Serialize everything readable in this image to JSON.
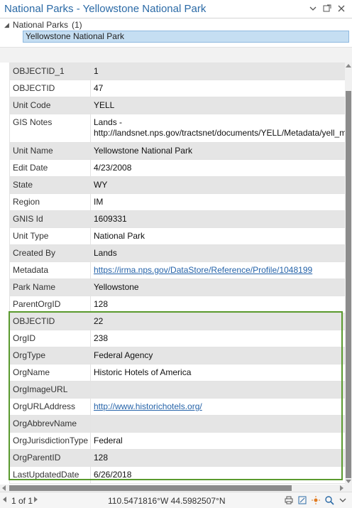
{
  "window": {
    "title": "National Parks - Yellowstone National Park"
  },
  "tree": {
    "layer_label": "National Parks",
    "layer_count": "(1)",
    "selected_feature": "Yellowstone National Park"
  },
  "attributes": [
    {
      "field": "OBJECTID_1",
      "value": "1"
    },
    {
      "field": "OBJECTID",
      "value": "47"
    },
    {
      "field": "Unit Code",
      "value": "YELL"
    },
    {
      "field": "GIS Notes",
      "value": "Lands - http://landsnet.nps.gov/tractsnet/documents/YELL/Metadata/yell_m"
    },
    {
      "field": "Unit Name",
      "value": "Yellowstone National Park"
    },
    {
      "field": "Edit Date",
      "value": "4/23/2008"
    },
    {
      "field": "State",
      "value": "WY"
    },
    {
      "field": "Region",
      "value": "IM"
    },
    {
      "field": "GNIS Id",
      "value": "1609331"
    },
    {
      "field": "Unit Type",
      "value": "National Park"
    },
    {
      "field": "Created By",
      "value": "Lands"
    },
    {
      "field": "Metadata",
      "value": "https://irma.nps.gov/DataStore/Reference/Profile/1048199"
    },
    {
      "field": "Park Name",
      "value": "Yellowstone"
    },
    {
      "field": "ParentOrgID",
      "value": "128"
    },
    {
      "field": "OBJECTID",
      "value": "22"
    },
    {
      "field": "OrgID",
      "value": "238"
    },
    {
      "field": "OrgType",
      "value": "Federal Agency"
    },
    {
      "field": "OrgName",
      "value": "Historic Hotels of America"
    },
    {
      "field": "OrgImageURL",
      "value": ""
    },
    {
      "field": "OrgURLAddress",
      "value": "http://www.historichotels.org/"
    },
    {
      "field": "OrgAbbrevName",
      "value": ""
    },
    {
      "field": "OrgJurisdictionType",
      "value": "Federal"
    },
    {
      "field": "OrgParentID",
      "value": "128"
    },
    {
      "field": "LastUpdatedDate",
      "value": "6/26/2018"
    }
  ],
  "status": {
    "page": "1 of 1",
    "coordinates": "110.5471816°W 44.5982507°N"
  },
  "colors": {
    "title": "#2b6aa6",
    "highlight": "#5a9a2e",
    "link": "#2563a9",
    "selected_row": "#c5def2"
  },
  "icons": [
    "options-menu-icon",
    "auto-hide-pin-icon",
    "close-icon",
    "print-icon",
    "export-icon",
    "flash-icon",
    "zoom-to-icon",
    "options-icon"
  ]
}
